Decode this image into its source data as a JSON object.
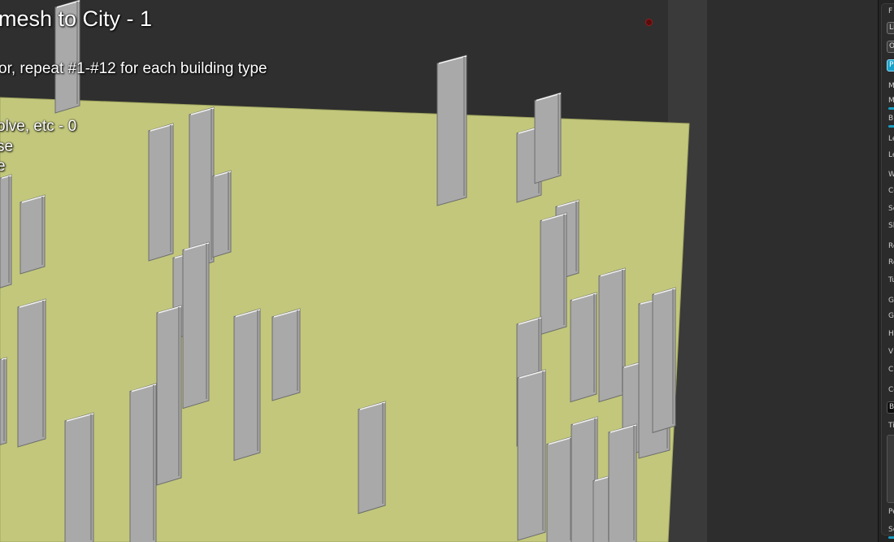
{
  "viewport": {
    "title": "mesh to City - 1",
    "instruction_line": "or, repeat #1-#12 for each building type",
    "option_lines": [
      "olve, etc - 0",
      "se",
      "e"
    ],
    "colors": {
      "ground": "#c2c77c",
      "ground_edge": "#b4b96e",
      "building": "#a9a9a9",
      "building_side": "#8d8d8d",
      "background": "#2f2f2f"
    }
  },
  "panel": {
    "header": "F",
    "buttons": [
      "Li",
      "O",
      "Pr"
    ],
    "items": [
      "M",
      "M",
      "B",
      "Le",
      "Le",
      "W",
      "Co",
      "Sc",
      "Sl",
      "Re",
      "Re",
      "Tu",
      "Gr",
      "Gr",
      "H",
      "V",
      "Cl",
      "Co",
      "Ba",
      "Ti",
      "Pe",
      "Se"
    ],
    "accent": "#1aa0c8"
  }
}
